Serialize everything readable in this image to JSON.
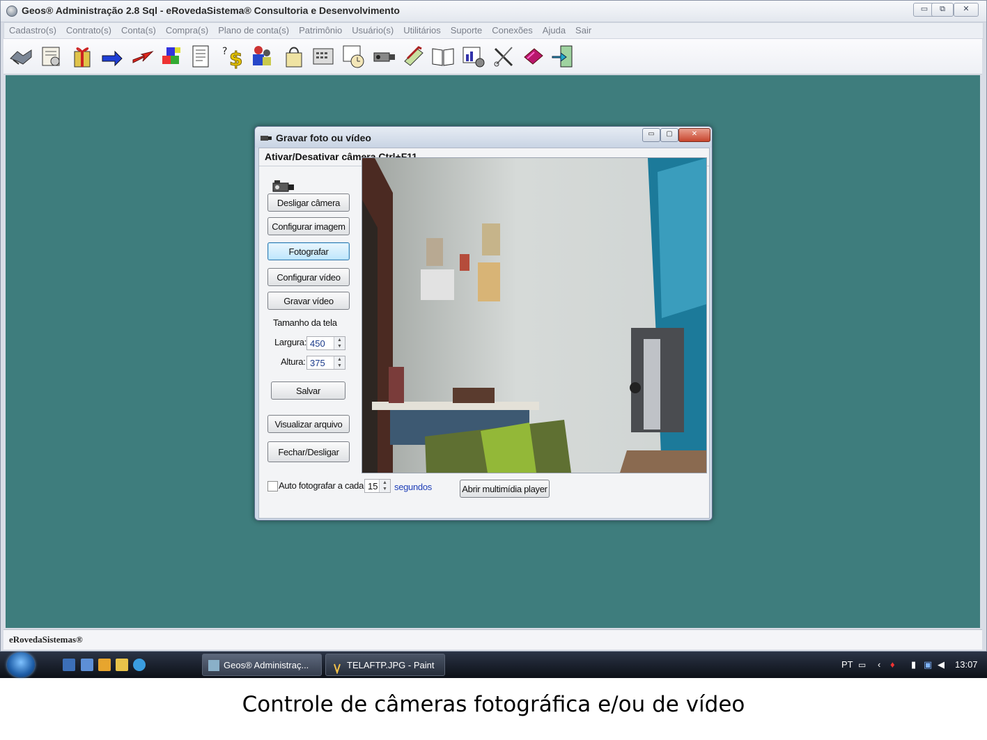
{
  "app": {
    "title": "Geos® Administração 2.8 Sql - eRovedaSistema® Consultoria e Desenvolvimento",
    "window_controls": [
      "▭",
      "⧉",
      "✕"
    ],
    "menu": [
      "Cadastro(s)",
      "Contrato(s)",
      "Conta(s)",
      "Compra(s)",
      "Plano de conta(s)",
      "Patrimônio",
      "Usuário(s)",
      "Utilitários",
      "Suporte",
      "Conexões",
      "Ajuda",
      "Sair"
    ],
    "toolbar_icons": [
      "handshake-icon",
      "certificate-icon",
      "gift-icon",
      "blue-arrow-icon",
      "red-arrow-icon",
      "cubes-icon",
      "document-icon",
      "money-icon",
      "people-icon",
      "bag-icon",
      "calculator-icon",
      "calendar-clock-icon",
      "camera-icon",
      "books-icon",
      "open-book-icon",
      "chart-gear-icon",
      "tools-icon",
      "book-icon",
      "exit-door-icon"
    ],
    "status_text": "eRovedaSistemas®",
    "workspace_color": "#3e7d7d"
  },
  "dialog": {
    "title": "Gravar foto ou vídeo",
    "hint": "Ativar/Desativar câmera Ctrl+F11",
    "buttons": {
      "desligar_camera": "Desligar câmera",
      "configurar_imagem": "Configurar imagem",
      "fotografar": "Fotografar",
      "configurar_video": "Configurar vídeo",
      "gravar_video": "Gravar vídeo",
      "salvar": "Salvar",
      "visualizar_arquivo": "Visualizar arquivo",
      "fechar_desligar": "Fechar/Desligar",
      "abrir_player": "Abrir multimídia player"
    },
    "tamanho_label": "Tamanho da tela",
    "largura_label": "Largura:",
    "largura_value": "450",
    "altura_label": "Altura:",
    "altura_value": "375",
    "auto_label": "Auto fotografar a cada",
    "auto_value": "15",
    "auto_unit": "segundos",
    "auto_checked": false
  },
  "taskbar": {
    "tasks": [
      "Geos® Administraç...",
      "TELAFTP.JPG - Paint"
    ],
    "language": "PT",
    "clock": "13:07"
  },
  "caption": "Controle de câmeras fotográfica e/ou de vídeo"
}
